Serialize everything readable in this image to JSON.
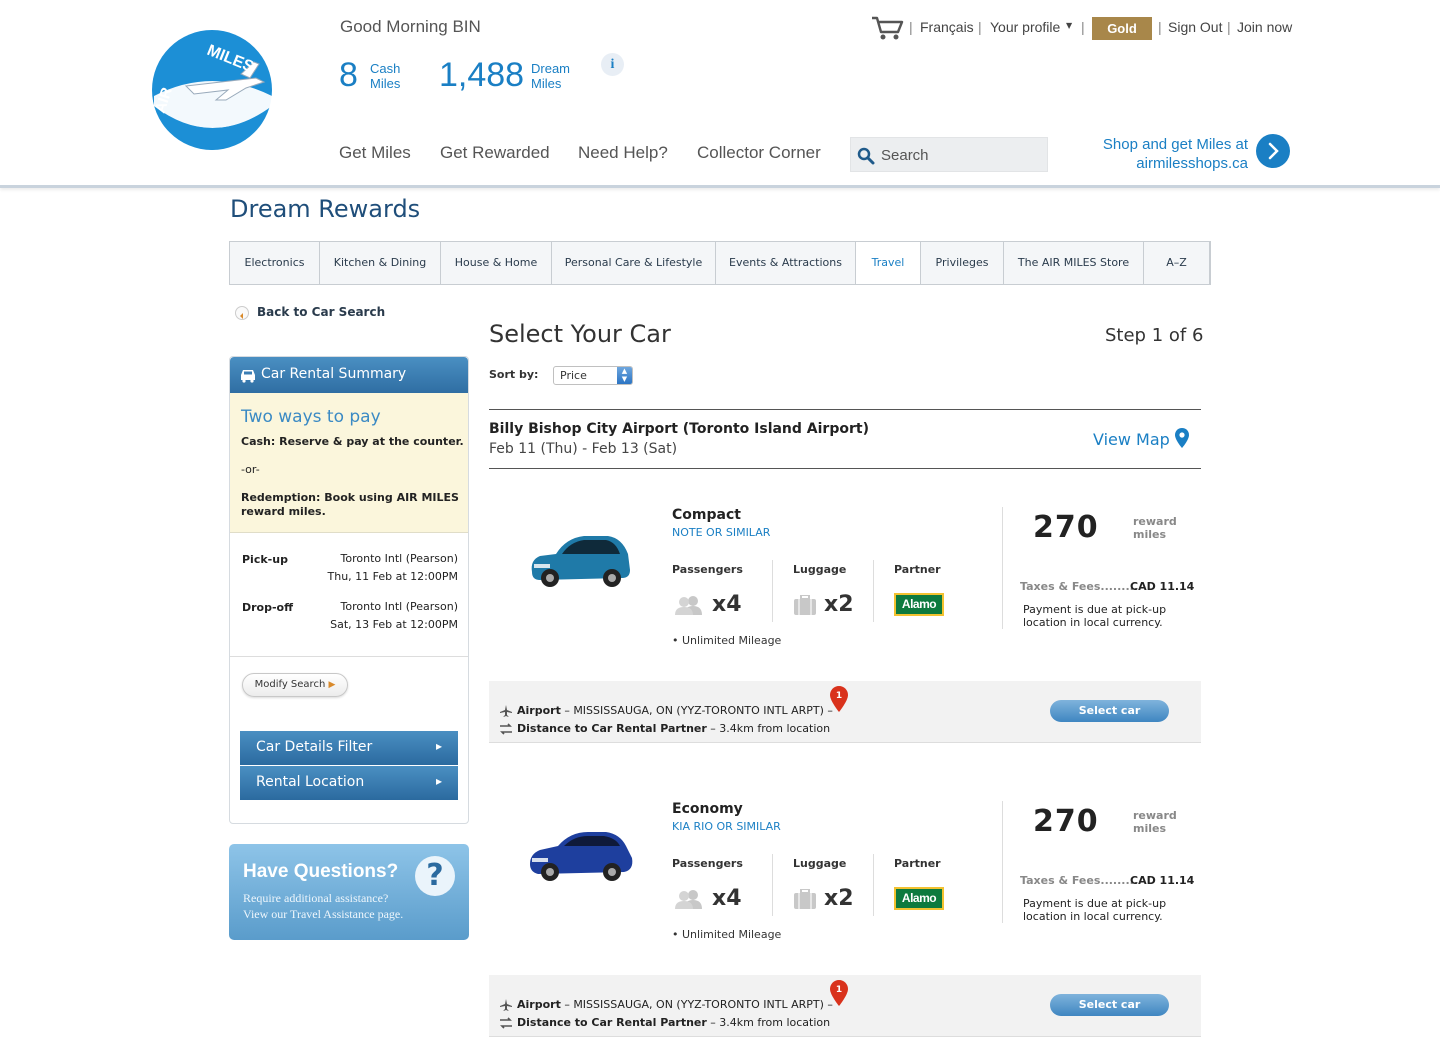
{
  "header": {
    "logo_text": "AIR MILES",
    "greeting": "Good Morning BIN",
    "cash_miles": {
      "value": "8",
      "label1": "Cash",
      "label2": "Miles"
    },
    "dream_miles": {
      "value": "1,488",
      "label1": "Dream",
      "label2": "Miles"
    },
    "info_icon": "i",
    "top_links": {
      "francais": "Français",
      "profile": "Your profile",
      "tier": "Gold",
      "sign_out": "Sign Out",
      "join": "Join now"
    },
    "separator": "|",
    "main_nav": [
      "Get Miles",
      "Get Rewarded",
      "Need Help?",
      "Collector Corner"
    ],
    "search": {
      "placeholder": "Search"
    },
    "shop": {
      "line1": "Shop and get Miles at",
      "line2": "airmilesshops.ca"
    }
  },
  "page": {
    "title": "Dream Rewards",
    "categories": [
      "Electronics",
      "Kitchen & Dining",
      "House & Home",
      "Personal Care & Lifestyle",
      "Events & Attractions",
      "Travel",
      "Privileges",
      "The AIR MILES Store",
      "A–Z"
    ],
    "active_category": "Travel",
    "back_link": "Back to Car Search"
  },
  "sidebar": {
    "summary_title": "Car Rental Summary",
    "ways_title": "Two ways to pay",
    "cash_text": "Cash: Reserve & pay at the counter.",
    "or_text": "-or-",
    "redemption_line1": "Redemption: Book using AIR MILES",
    "redemption_line2": "reward miles.",
    "pickup": {
      "label": "Pick-up",
      "location": "Toronto Intl (Pearson)",
      "time": "Thu, 11 Feb at 12:00PM"
    },
    "dropoff": {
      "label": "Drop-off",
      "location": "Toronto Intl (Pearson)",
      "time": "Sat, 13 Feb at 12:00PM"
    },
    "modify_button": "Modify Search",
    "filters": [
      "Car Details Filter",
      "Rental Location"
    ],
    "questions": {
      "title": "Have Questions?",
      "line1": "Require additional assistance?",
      "line2": "View our Travel Assistance page.",
      "mark": "?"
    }
  },
  "main": {
    "title": "Select Your Car",
    "step": "Step 1 of 6",
    "sort_label": "Sort by:",
    "sort_value": "Price",
    "location_name": "Billy Bishop City Airport (Toronto Island Airport)",
    "location_dates": "Feb 11 (Thu) - Feb 13 (Sat)",
    "view_map": "View Map",
    "column_labels": {
      "passengers": "Passengers",
      "luggage": "Luggage",
      "partner": "Partner"
    },
    "cars": [
      {
        "class": "Compact",
        "model": "NOTE OR SIMILAR",
        "color": "#1f7aa8",
        "passengers": "x4",
        "luggage": "x2",
        "partner": "Alamo",
        "mileage": "• Unlimited Mileage",
        "price": "270",
        "price_label1": "reward",
        "price_label2": "miles",
        "taxes_label": "Taxes & Fees.........",
        "taxes_value": "CAD 11.14",
        "payment_note1": "Payment is due at pick-up",
        "payment_note2": "location in local currency.",
        "airport_label": "Airport",
        "airport_value": " – MISSISSAUGA, ON (YYZ-TORONTO INTL ARPT) –",
        "distance_label": "Distance to Car Rental Partner",
        "distance_value": " – 3.4km from location",
        "pin_number": "1",
        "select_button": "Select  car"
      },
      {
        "class": "Economy",
        "model": "KIA RIO OR SIMILAR",
        "color": "#1e3f9e",
        "passengers": "x4",
        "luggage": "x2",
        "partner": "Alamo",
        "mileage": "• Unlimited Mileage",
        "price": "270",
        "price_label1": "reward",
        "price_label2": "miles",
        "taxes_label": "Taxes & Fees.........",
        "taxes_value": "CAD 11.14",
        "payment_note1": "Payment is due at pick-up",
        "payment_note2": "location in local currency.",
        "airport_label": "Airport",
        "airport_value": " – MISSISSAUGA, ON (YYZ-TORONTO INTL ARPT) –",
        "distance_label": "Distance to Car Rental Partner",
        "distance_value": " – 3.4km from location",
        "pin_number": "1",
        "select_button": "Select  car"
      }
    ]
  }
}
